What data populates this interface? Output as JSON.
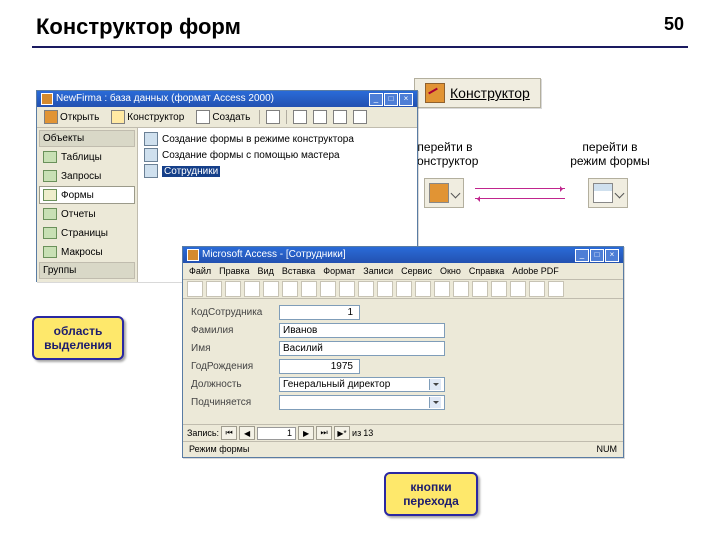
{
  "page": {
    "title": "Конструктор форм",
    "number": "50"
  },
  "bigButton": {
    "label": "Конструктор"
  },
  "labels": {
    "toConstructor1": "перейти в",
    "toConstructor2": "конструктор",
    "toForm1": "перейти в",
    "toForm2": "режим формы"
  },
  "callouts": {
    "selection1": "область",
    "selection2": "выделения",
    "nav1": "кнопки",
    "nav2": "перехода"
  },
  "dbWin": {
    "title": "NewFirma : база данных (формат Access 2000)",
    "toolbar": {
      "open": "Открыть",
      "constructor": "Конструктор",
      "create": "Создать"
    },
    "objectsHeader": "Объекты",
    "items": [
      "Таблицы",
      "Запросы",
      "Формы",
      "Отчеты",
      "Страницы",
      "Макросы",
      "Группы"
    ],
    "list": [
      "Создание формы в режиме конструктора",
      "Создание формы с помощью мастера",
      "Сотрудники"
    ]
  },
  "formWin": {
    "title": "Microsoft Access - [Сотрудники]",
    "menu": [
      "Файл",
      "Правка",
      "Вид",
      "Вставка",
      "Формат",
      "Записи",
      "Сервис",
      "Окно",
      "Справка",
      "Adobe PDF"
    ],
    "fields": {
      "codeLabel": "КодСотрудника",
      "code": "1",
      "surnameLabel": "Фамилия",
      "surname": "Иванов",
      "nameLabel": "Имя",
      "name": "Василий",
      "yearLabel": "ГодРождения",
      "year": "1975",
      "positionLabel": "Должность",
      "position": "Генеральный директор",
      "subordLabel": "Подчиняется",
      "subord": ""
    },
    "record": {
      "label": "Запись:",
      "current": "1",
      "ofLabel": "из",
      "total": "13"
    },
    "status": {
      "mode": "Режим формы",
      "num": "NUM"
    }
  }
}
